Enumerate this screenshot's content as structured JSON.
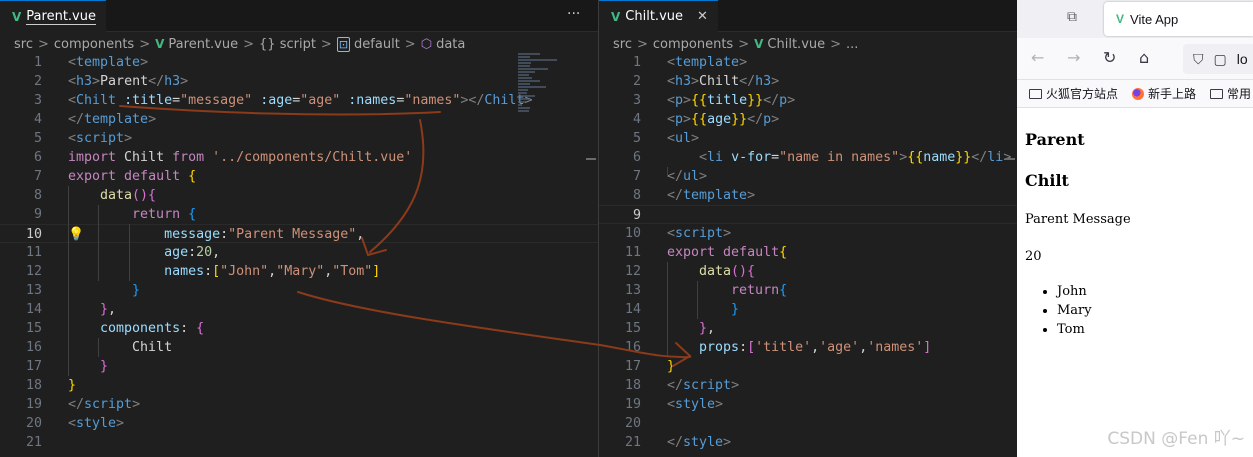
{
  "left_editor": {
    "tab": {
      "label": "Parent.vue"
    },
    "more_label": "···",
    "breadcrumb": [
      "src",
      "components",
      "Parent.vue",
      "{} script",
      "default",
      "data"
    ],
    "lines": [
      {
        "n": "1",
        "c": [
          [
            "  <",
            "br"
          ],
          [
            "template",
            "tag"
          ],
          [
            ">",
            "br"
          ]
        ]
      },
      {
        "n": "2",
        "c": [
          [
            "  <",
            "br"
          ],
          [
            "h3",
            "tag"
          ],
          [
            ">",
            "br"
          ],
          [
            "Parent",
            "def"
          ],
          [
            "</",
            "br"
          ],
          [
            "h3",
            "tag"
          ],
          [
            ">",
            "br"
          ]
        ]
      },
      {
        "n": "3",
        "c": [
          [
            "  <",
            "br"
          ],
          [
            "Chilt ",
            "tag"
          ],
          [
            ":title",
            "attr"
          ],
          [
            "=",
            "def"
          ],
          [
            "\"message\"",
            "str"
          ],
          [
            " :age",
            "attr"
          ],
          [
            "=",
            "def"
          ],
          [
            "\"age\"",
            "str"
          ],
          [
            " :names",
            "attr"
          ],
          [
            "=",
            "def"
          ],
          [
            "\"names\"",
            "str"
          ],
          [
            "></",
            "br"
          ],
          [
            "Chilt",
            "tag"
          ],
          [
            ">",
            "br"
          ]
        ]
      },
      {
        "n": "4",
        "c": [
          [
            "  </",
            "br"
          ],
          [
            "template",
            "tag"
          ],
          [
            ">",
            "br"
          ]
        ]
      },
      {
        "n": "5",
        "c": [
          [
            "  <",
            "br"
          ],
          [
            "script",
            "tag"
          ],
          [
            ">",
            "br"
          ]
        ]
      },
      {
        "n": "6",
        "c": [
          [
            "  import ",
            "ctl"
          ],
          [
            "Chilt ",
            "def"
          ],
          [
            "from ",
            "ctl"
          ],
          [
            "'../components/Chilt.vue'",
            "str"
          ]
        ]
      },
      {
        "n": "7",
        "c": [
          [
            "  export ",
            "ctl"
          ],
          [
            "default ",
            "ctl"
          ],
          [
            "{",
            "y"
          ]
        ]
      },
      {
        "n": "8",
        "c": [
          [
            "      data",
            "fn"
          ],
          [
            "(){",
            "p"
          ]
        ]
      },
      {
        "n": "9",
        "c": [
          [
            "          return ",
            "ctl"
          ],
          [
            "{",
            "b"
          ]
        ]
      },
      {
        "n": "10",
        "c": [
          [
            "              message",
            "attr"
          ],
          [
            ":",
            "def"
          ],
          [
            "\"Parent Message\"",
            "str"
          ],
          [
            ",",
            "def"
          ]
        ]
      },
      {
        "n": "11",
        "c": [
          [
            "              age",
            "attr"
          ],
          [
            ":",
            "def"
          ],
          [
            "20",
            "num"
          ],
          [
            ",",
            "def"
          ]
        ]
      },
      {
        "n": "12",
        "c": [
          [
            "              names",
            "attr"
          ],
          [
            ":",
            "def"
          ],
          [
            "[",
            "y"
          ],
          [
            "\"John\"",
            "str"
          ],
          [
            ",",
            "def"
          ],
          [
            "\"Mary\"",
            "str"
          ],
          [
            ",",
            "def"
          ],
          [
            "\"Tom\"",
            "str"
          ],
          [
            "]",
            "y"
          ]
        ]
      },
      {
        "n": "13",
        "c": [
          [
            "          }",
            "b"
          ]
        ]
      },
      {
        "n": "14",
        "c": [
          [
            "      }",
            "p"
          ],
          [
            ",",
            "def"
          ]
        ]
      },
      {
        "n": "15",
        "c": [
          [
            "      components",
            "attr"
          ],
          [
            ": ",
            "def"
          ],
          [
            "{",
            "p"
          ]
        ]
      },
      {
        "n": "16",
        "c": [
          [
            "          Chilt",
            "def"
          ]
        ]
      },
      {
        "n": "17",
        "c": [
          [
            "      }",
            "p"
          ]
        ]
      },
      {
        "n": "18",
        "c": [
          [
            "  }",
            "y"
          ]
        ]
      },
      {
        "n": "19",
        "c": [
          [
            "  </",
            "br"
          ],
          [
            "script",
            "tag"
          ],
          [
            ">",
            "br"
          ]
        ]
      },
      {
        "n": "20",
        "c": [
          [
            "  <",
            "br"
          ],
          [
            "style",
            "tag"
          ],
          [
            ">",
            "br"
          ]
        ]
      },
      {
        "n": "21",
        "c": []
      }
    ]
  },
  "right_editor": {
    "tab": {
      "label": "Chilt.vue",
      "close": "✕"
    },
    "breadcrumb": [
      "src",
      "components",
      "Chilt.vue",
      "..."
    ],
    "lines": [
      {
        "n": "1",
        "c": [
          [
            "  <",
            "br"
          ],
          [
            "template",
            "tag"
          ],
          [
            ">",
            "br"
          ]
        ]
      },
      {
        "n": "2",
        "c": [
          [
            "  <",
            "br"
          ],
          [
            "h3",
            "tag"
          ],
          [
            ">",
            "br"
          ],
          [
            "Chilt",
            "def"
          ],
          [
            "</",
            "br"
          ],
          [
            "h3",
            "tag"
          ],
          [
            ">",
            "br"
          ]
        ]
      },
      {
        "n": "3",
        "c": [
          [
            "  <",
            "br"
          ],
          [
            "p",
            "tag"
          ],
          [
            ">",
            "br"
          ],
          [
            "{{",
            "mus"
          ],
          [
            "title",
            "attr"
          ],
          [
            "}}",
            "mus"
          ],
          [
            "</",
            "br"
          ],
          [
            "p",
            "tag"
          ],
          [
            ">",
            "br"
          ]
        ]
      },
      {
        "n": "4",
        "c": [
          [
            "  <",
            "br"
          ],
          [
            "p",
            "tag"
          ],
          [
            ">",
            "br"
          ],
          [
            "{{",
            "mus"
          ],
          [
            "age",
            "attr"
          ],
          [
            "}}",
            "mus"
          ],
          [
            "</",
            "br"
          ],
          [
            "p",
            "tag"
          ],
          [
            ">",
            "br"
          ]
        ]
      },
      {
        "n": "5",
        "c": [
          [
            "  <",
            "br"
          ],
          [
            "ul",
            "tag"
          ],
          [
            ">",
            "br"
          ]
        ]
      },
      {
        "n": "6",
        "c": [
          [
            "      <",
            "br"
          ],
          [
            "li ",
            "tag"
          ],
          [
            "v-for",
            "attr"
          ],
          [
            "=",
            "def"
          ],
          [
            "\"name in names\"",
            "str"
          ],
          [
            ">",
            "br"
          ],
          [
            "{{",
            "mus"
          ],
          [
            "name",
            "attr"
          ],
          [
            "}}",
            "mus"
          ],
          [
            "</",
            "br"
          ],
          [
            "li",
            "tag"
          ],
          [
            ">",
            "br"
          ]
        ]
      },
      {
        "n": "7",
        "c": [
          [
            "  </",
            "br"
          ],
          [
            "ul",
            "tag"
          ],
          [
            ">",
            "br"
          ]
        ]
      },
      {
        "n": "8",
        "c": [
          [
            "  </",
            "br"
          ],
          [
            "template",
            "tag"
          ],
          [
            ">",
            "br"
          ]
        ]
      },
      {
        "n": "9",
        "c": []
      },
      {
        "n": "10",
        "c": [
          [
            "  <",
            "br"
          ],
          [
            "script",
            "tag"
          ],
          [
            ">",
            "br"
          ]
        ]
      },
      {
        "n": "11",
        "c": [
          [
            "  export ",
            "ctl"
          ],
          [
            "default",
            "ctl"
          ],
          [
            "{",
            "y"
          ]
        ]
      },
      {
        "n": "12",
        "c": [
          [
            "      data",
            "fn"
          ],
          [
            "(){",
            "p"
          ]
        ]
      },
      {
        "n": "13",
        "c": [
          [
            "          return",
            "ctl"
          ],
          [
            "{",
            "b"
          ]
        ]
      },
      {
        "n": "14",
        "c": [
          [
            "          }",
            "b"
          ]
        ]
      },
      {
        "n": "15",
        "c": [
          [
            "      }",
            "p"
          ],
          [
            ",",
            "def"
          ]
        ]
      },
      {
        "n": "16",
        "c": [
          [
            "      props",
            "attr"
          ],
          [
            ":",
            "def"
          ],
          [
            "[",
            "p"
          ],
          [
            "'title'",
            "str"
          ],
          [
            ",",
            "def"
          ],
          [
            "'age'",
            "str"
          ],
          [
            ",",
            "def"
          ],
          [
            "'names'",
            "str"
          ],
          [
            "]",
            "p"
          ]
        ]
      },
      {
        "n": "17",
        "c": [
          [
            "  }",
            "y"
          ]
        ]
      },
      {
        "n": "18",
        "c": [
          [
            "  </",
            "br"
          ],
          [
            "script",
            "tag"
          ],
          [
            ">",
            "br"
          ]
        ]
      },
      {
        "n": "19",
        "c": [
          [
            "  <",
            "br"
          ],
          [
            "style",
            "tag"
          ],
          [
            ">",
            "br"
          ]
        ]
      },
      {
        "n": "20",
        "c": []
      },
      {
        "n": "21",
        "c": [
          [
            "  </",
            "br"
          ],
          [
            "style",
            "tag"
          ],
          [
            ">",
            "br"
          ]
        ]
      }
    ]
  },
  "browser": {
    "tab_title": "Vite App",
    "url_partial": "lo",
    "bookmarks": [
      "火狐官方站点",
      "新手上路",
      "常用"
    ],
    "page": {
      "h3_parent": "Parent",
      "h3_child": "Chilt",
      "title_text": "Parent Message",
      "age_text": "20",
      "names": [
        "John",
        "Mary",
        "Tom"
      ]
    }
  },
  "watermark": "CSDN @Fen 吖~",
  "colors": {
    "annotation_stroke": "#8b3a1a",
    "vue_green": "#42b883",
    "editor_bg": "#1f1f1f"
  }
}
